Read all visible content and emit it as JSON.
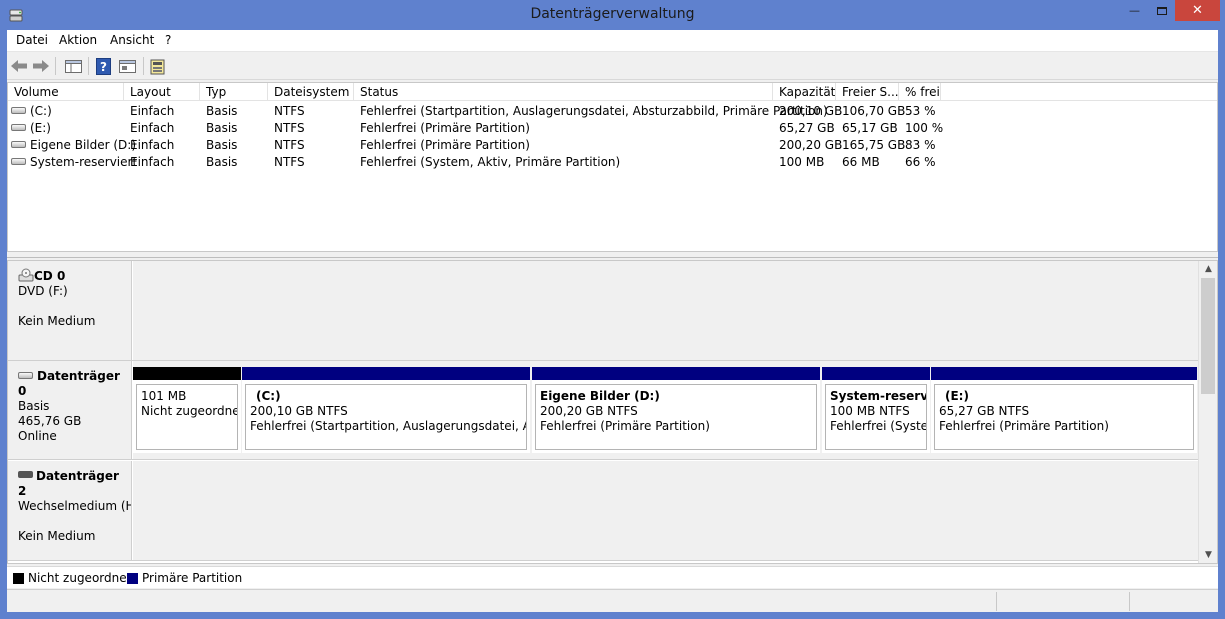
{
  "window": {
    "title": "Datenträgerverwaltung"
  },
  "menu": [
    "Datei",
    "Aktion",
    "Ansicht",
    "?"
  ],
  "toolbar": {
    "icons": [
      "back-arrow-icon",
      "forward-arrow-icon",
      "console-tree-icon",
      "help-icon",
      "properties-icon",
      "disk-settings-icon"
    ]
  },
  "volume_list": {
    "columns": [
      "Volume",
      "Layout",
      "Typ",
      "Dateisystem",
      "Status",
      "Kapazität",
      "Freier S...",
      "% frei"
    ],
    "rows": [
      {
        "volume": "(C:)",
        "layout": "Einfach",
        "typ": "Basis",
        "fs": "NTFS",
        "status": "Fehlerfrei (Startpartition, Auslagerungsdatei, Absturzabbild, Primäre Partition)",
        "kap": "200,10 GB",
        "frei": "106,70 GB",
        "pct": "53 %"
      },
      {
        "volume": "(E:)",
        "layout": "Einfach",
        "typ": "Basis",
        "fs": "NTFS",
        "status": "Fehlerfrei (Primäre Partition)",
        "kap": "65,27 GB",
        "frei": "65,17 GB",
        "pct": "100 %"
      },
      {
        "volume": "Eigene Bilder (D:)",
        "layout": "Einfach",
        "typ": "Basis",
        "fs": "NTFS",
        "status": "Fehlerfrei (Primäre Partition)",
        "kap": "200,20 GB",
        "frei": "165,75 GB",
        "pct": "83 %"
      },
      {
        "volume": "System-reserviert",
        "layout": "Einfach",
        "typ": "Basis",
        "fs": "NTFS",
        "status": "Fehlerfrei (System, Aktiv, Primäre Partition)",
        "kap": "100 MB",
        "frei": "66 MB",
        "pct": "66 %"
      }
    ]
  },
  "disks": [
    {
      "name": "CD 0",
      "line1": "DVD (F:)",
      "line2": "",
      "line3": "Kein Medium",
      "partitions": []
    },
    {
      "name": "Datenträger 0",
      "line1": "Basis",
      "line2": "465,76 GB",
      "line3": "Online",
      "partitions": [
        {
          "title": "",
          "size": "101 MB",
          "status": "Nicht zugeordnet",
          "kind": "unallocated"
        },
        {
          "title": "(C:)",
          "size": "200,10 GB NTFS",
          "status": "Fehlerfrei (Startpartition, Auslagerungsdatei, Absturz",
          "kind": "primary"
        },
        {
          "title": "Eigene Bilder  (D:)",
          "size": "200,20 GB NTFS",
          "status": "Fehlerfrei (Primäre Partition)",
          "kind": "primary"
        },
        {
          "title": "System-reservie",
          "size": "100 MB NTFS",
          "status": "Fehlerfrei (System",
          "kind": "primary"
        },
        {
          "title": "(E:)",
          "size": "65,27 GB NTFS",
          "status": "Fehlerfrei (Primäre Partition)",
          "kind": "primary"
        }
      ]
    },
    {
      "name": "Datenträger 2",
      "line1": "Wechselmedium (H",
      "line2": "",
      "line3": "Kein Medium",
      "partitions": []
    }
  ],
  "legend": [
    {
      "label": "Nicht zugeordnet",
      "color": "#000000"
    },
    {
      "label": "Primäre Partition",
      "color": "#000080"
    }
  ],
  "colors": {
    "titlebar": "#5f81ce",
    "close": "#c9463d",
    "primary": "#000080",
    "unallocated": "#000000"
  }
}
